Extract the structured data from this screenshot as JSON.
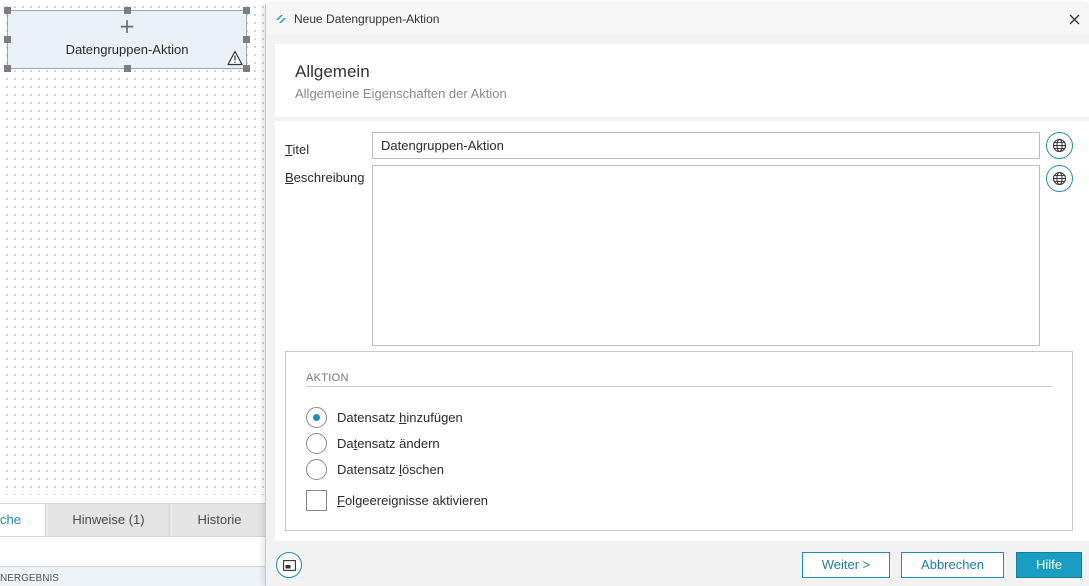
{
  "canvas": {
    "node_label": "Datengruppen-Aktion",
    "plus": "+"
  },
  "bottom_panel": {
    "tabs": [
      {
        "label": "che",
        "active": true
      },
      {
        "label": "Hinweise (1)",
        "active": false
      },
      {
        "label": "Historie",
        "active": false
      }
    ],
    "status_text": "NERGEBNIS"
  },
  "dialog": {
    "title": "Neue Datengruppen-Aktion",
    "header": {
      "title": "Allgemein",
      "subtitle": "Allgemeine Eigenschaften der Aktion"
    },
    "fields": {
      "titel_label_mnemonic": "T",
      "titel_label_rest": "itel",
      "titel_value": "Datengruppen-Aktion",
      "beschreibung_label_mnemonic": "B",
      "beschreibung_label_rest": "eschreibung",
      "beschreibung_value": ""
    },
    "action_group": {
      "title": "AKTION",
      "options": [
        {
          "pre": "Datensatz ",
          "mnemonic": "h",
          "post": "inzufügen",
          "checked": true
        },
        {
          "pre": "Da",
          "mnemonic": "t",
          "post": "ensatz ändern",
          "checked": false
        },
        {
          "pre": "Datensatz ",
          "mnemonic": "l",
          "post": "öschen",
          "checked": false
        }
      ],
      "checkbox": {
        "pre": "",
        "mnemonic": "F",
        "post": "olgeereignisse aktivieren",
        "checked": false
      }
    },
    "buttons": {
      "next": "Weiter >",
      "cancel": "Abbrechen",
      "help": "Hilfe"
    }
  },
  "colors": {
    "accent": "#1a9dc3",
    "accent_dark": "#1a8fb5"
  }
}
